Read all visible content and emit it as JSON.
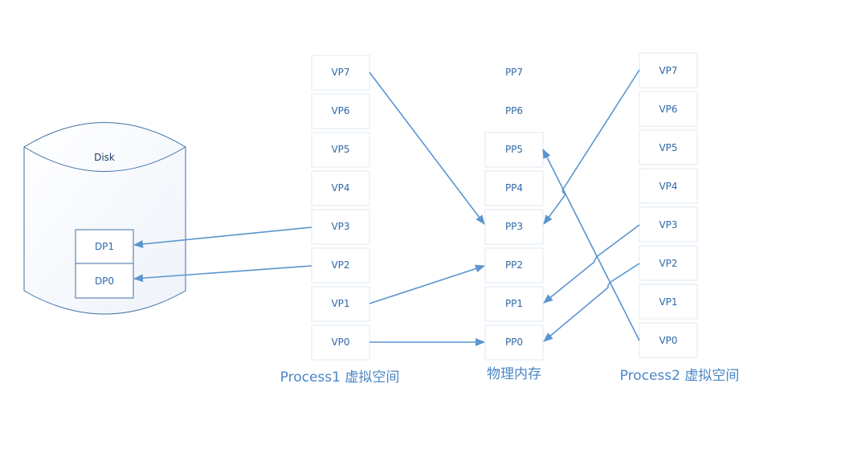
{
  "disk": {
    "label": "Disk",
    "pages": [
      "DP1",
      "DP0"
    ]
  },
  "process1": {
    "title": "Process1 虚拟空间",
    "pages": [
      "VP7",
      "VP6",
      "VP5",
      "VP4",
      "VP3",
      "VP2",
      "VP1",
      "VP0"
    ]
  },
  "memory": {
    "title": "物理内存",
    "pages": [
      "PP7",
      "PP6",
      "PP5",
      "PP4",
      "PP3",
      "PP2",
      "PP1",
      "PP0"
    ]
  },
  "process2": {
    "title": "Process2 虚拟空间",
    "pages": [
      "VP7",
      "VP6",
      "VP5",
      "VP4",
      "VP3",
      "VP2",
      "VP1",
      "VP0"
    ]
  },
  "colors": {
    "line": "#5b95d0",
    "text": "#2f6aa8",
    "title": "#4a86c6",
    "box_border": "#dfe8f3"
  },
  "mappings": [
    {
      "from": "process1.VP7",
      "to": "memory.PP3"
    },
    {
      "from": "process1.VP3",
      "to": "disk.DP1"
    },
    {
      "from": "process1.VP2",
      "to": "disk.DP0"
    },
    {
      "from": "process1.VP1",
      "to": "memory.PP2"
    },
    {
      "from": "process1.VP0",
      "to": "memory.PP0"
    },
    {
      "from": "process2.VP7",
      "to": "memory.PP3"
    },
    {
      "from": "process2.VP3",
      "to": "memory.PP1"
    },
    {
      "from": "process2.VP2",
      "to": "memory.PP0"
    },
    {
      "from": "process2.VP0",
      "to": "memory.PP5"
    }
  ]
}
